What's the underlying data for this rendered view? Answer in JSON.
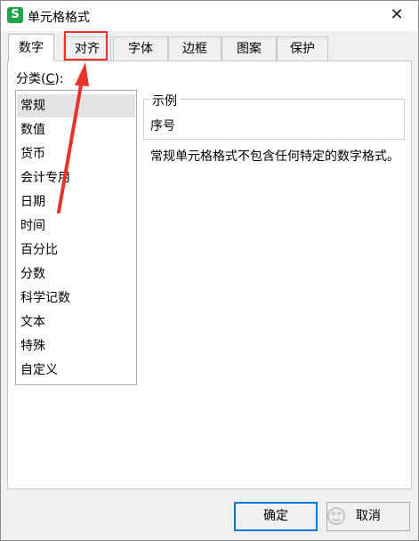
{
  "window": {
    "title": "单元格格式",
    "icon_letter": "S",
    "close_glyph": "✕"
  },
  "tabs": [
    {
      "label": "数字",
      "active": true
    },
    {
      "label": "对齐",
      "active": false
    },
    {
      "label": "字体",
      "active": false
    },
    {
      "label": "边框",
      "active": false
    },
    {
      "label": "图案",
      "active": false
    },
    {
      "label": "保护",
      "active": false
    }
  ],
  "category": {
    "label_prefix": "分类(",
    "label_hotkey": "C",
    "label_suffix": "):",
    "items": [
      "常规",
      "数值",
      "货币",
      "会计专用",
      "日期",
      "时间",
      "百分比",
      "分数",
      "科学记数",
      "文本",
      "特殊",
      "自定义"
    ],
    "selected": "常规"
  },
  "sample": {
    "legend": "示例",
    "value": "序号"
  },
  "description": "常规单元格格式不包含任何特定的数字格式。",
  "buttons": {
    "ok": "确定",
    "cancel": "取消"
  },
  "annotation": {
    "highlight_color": "#e8332c"
  }
}
